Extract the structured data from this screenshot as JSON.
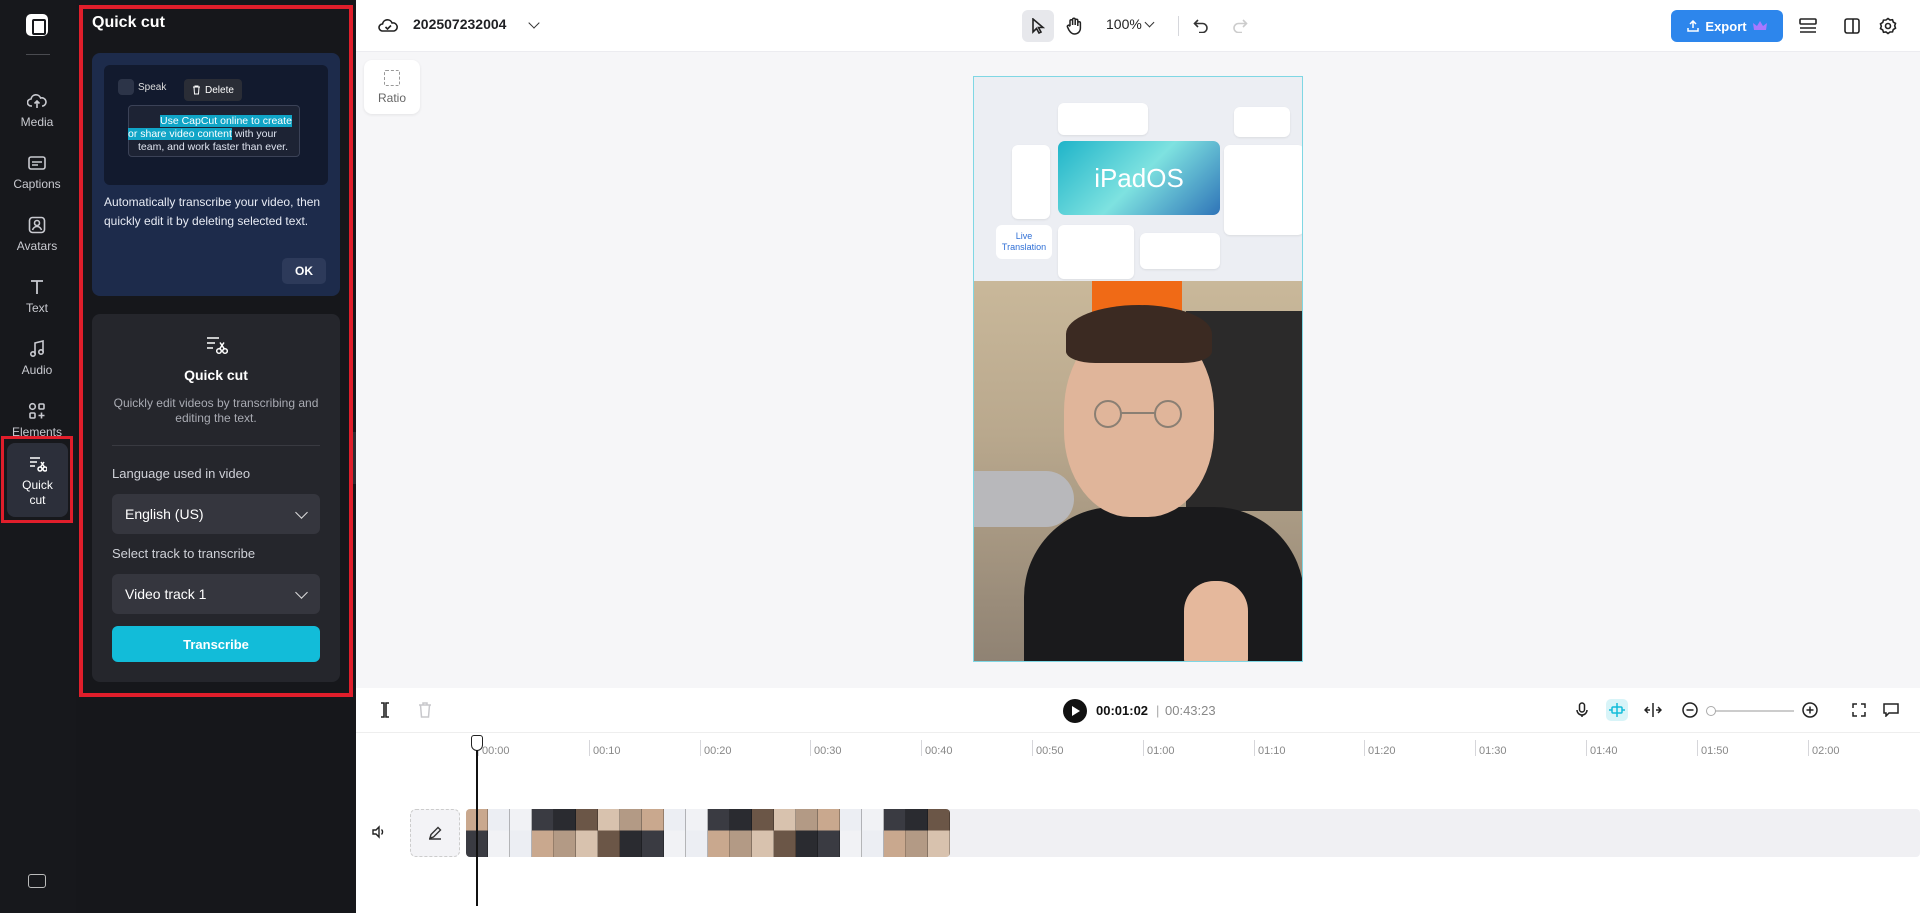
{
  "rail": {
    "items": [
      {
        "label": "Media",
        "icon": "cloud-upload-icon"
      },
      {
        "label": "Captions",
        "icon": "captions-icon"
      },
      {
        "label": "Avatars",
        "icon": "avatar-icon"
      },
      {
        "label": "Text",
        "icon": "text-icon"
      },
      {
        "label": "Audio",
        "icon": "music-note-icon"
      },
      {
        "label": "Elements",
        "icon": "elements-icon"
      },
      {
        "label": "Quick cut",
        "icon": "quick-cut-icon"
      }
    ],
    "active": "Quick cut"
  },
  "panel": {
    "title": "Quick cut",
    "tip": {
      "preview_speaker": "Speak",
      "preview_delete": "Delete",
      "preview_line1_highlight": "Use CapCut online to create",
      "preview_line2_highlight": "or share video content",
      "preview_line2_rest": " with your",
      "preview_line3": "team, and work faster than ever.",
      "text": "Automatically transcribe your video, then quickly edit it by deleting selected text.",
      "ok_label": "OK"
    },
    "card": {
      "title": "Quick cut",
      "description": "Quickly edit videos by transcribing and editing the text.",
      "language_label": "Language used in video",
      "language_value": "English (US)",
      "track_label": "Select track to transcribe",
      "track_value": "Video track 1",
      "transcribe_label": "Transcribe"
    }
  },
  "topbar": {
    "project_name": "202507232004",
    "zoom": "100%",
    "export_label": "Export"
  },
  "canvas": {
    "ratio_label": "Ratio",
    "preview_title": "iPadOS",
    "preview_live_translation": "Live Translation"
  },
  "timeline": {
    "current_time": "00:01:02",
    "separator": "|",
    "total_time": "00:43:23",
    "ticks": [
      "00:00",
      "00:10",
      "00:20",
      "00:30",
      "00:40",
      "00:50",
      "01:00",
      "01:10",
      "01:20",
      "01:30",
      "01:40",
      "01:50",
      "02:00"
    ]
  },
  "colors": {
    "accent": "#12bcd9",
    "export": "#2d86ec",
    "highlight": "#e01e2b"
  }
}
